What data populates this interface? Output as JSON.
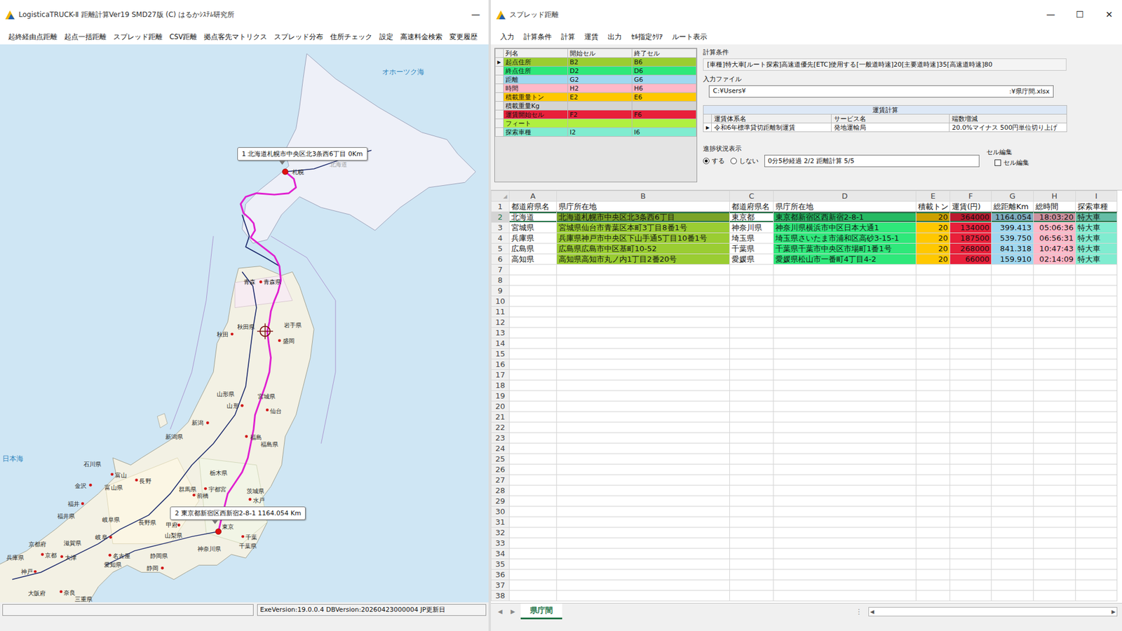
{
  "map_window": {
    "title": "LogisticaTRUCK-Ⅱ 距離計算Ver19 SMD27版 (C) はるかｼｽﾃﾑ研究所",
    "controls": [
      "—"
    ],
    "menu": [
      "起終経由点距離",
      "起点一括距離",
      "スプレッド距離",
      "CSV距離",
      "拠点客先マトリクス",
      "スプレッド分布",
      "住所チェック",
      "設定",
      "高速料金検索",
      "変更履歴"
    ],
    "labels": [
      {
        "text": "オホーツク海",
        "kind": "sea"
      },
      {
        "text": "日本海",
        "kind": "sea"
      },
      {
        "text": "北海道",
        "kind": "region"
      },
      {
        "text": "札幌",
        "kind": "pref"
      },
      {
        "text": "青森",
        "kind": "city"
      },
      {
        "text": "青森県",
        "kind": "pref"
      },
      {
        "text": "秋田県",
        "kind": "pref"
      },
      {
        "text": "秋田",
        "kind": "city"
      },
      {
        "text": "岩手県",
        "kind": "pref"
      },
      {
        "text": "盛岡",
        "kind": "city"
      },
      {
        "text": "山形県",
        "kind": "pref"
      },
      {
        "text": "山形",
        "kind": "city"
      },
      {
        "text": "宮城県",
        "kind": "pref"
      },
      {
        "text": "仙台",
        "kind": "city"
      },
      {
        "text": "新潟",
        "kind": "city"
      },
      {
        "text": "新潟県",
        "kind": "pref"
      },
      {
        "text": "福島",
        "kind": "city"
      },
      {
        "text": "福島県",
        "kind": "pref"
      },
      {
        "text": "栃木県",
        "kind": "pref"
      },
      {
        "text": "宇都宮",
        "kind": "city"
      },
      {
        "text": "群馬県",
        "kind": "pref"
      },
      {
        "text": "前橋",
        "kind": "city"
      },
      {
        "text": "茨城県",
        "kind": "pref"
      },
      {
        "text": "水戸",
        "kind": "city"
      },
      {
        "text": "石川県",
        "kind": "pref"
      },
      {
        "text": "富山",
        "kind": "city"
      },
      {
        "text": "金沢",
        "kind": "city"
      },
      {
        "text": "富山県",
        "kind": "pref"
      },
      {
        "text": "長野",
        "kind": "city"
      },
      {
        "text": "福井",
        "kind": "city"
      },
      {
        "text": "福井県",
        "kind": "pref"
      },
      {
        "text": "岐阜県",
        "kind": "pref"
      },
      {
        "text": "長野県",
        "kind": "pref"
      },
      {
        "text": "甲府",
        "kind": "city"
      },
      {
        "text": "山梨県",
        "kind": "pref"
      },
      {
        "text": "東京",
        "kind": "pref"
      },
      {
        "text": "千葉",
        "kind": "city"
      },
      {
        "text": "千葉県",
        "kind": "pref"
      },
      {
        "text": "神奈川県",
        "kind": "pref"
      },
      {
        "text": "岐阜",
        "kind": "city"
      },
      {
        "text": "名古屋",
        "kind": "city"
      },
      {
        "text": "愛知県",
        "kind": "pref"
      },
      {
        "text": "静岡県",
        "kind": "pref"
      },
      {
        "text": "静岡",
        "kind": "city"
      },
      {
        "text": "滋賀県",
        "kind": "pref"
      },
      {
        "text": "京都府",
        "kind": "pref"
      },
      {
        "text": "京都",
        "kind": "city"
      },
      {
        "text": "大津",
        "kind": "city"
      },
      {
        "text": "兵庫県",
        "kind": "pref"
      },
      {
        "text": "神戸",
        "kind": "city"
      },
      {
        "text": "大阪府",
        "kind": "pref"
      },
      {
        "text": "奈良",
        "kind": "city"
      },
      {
        "text": "三重県",
        "kind": "pref"
      }
    ],
    "callouts": [
      "1 北海道札幌市中央区北3条西6丁目 0Km",
      "2 東京都新宿区西新宿2-8-1 1164.054 Km"
    ],
    "status_bar": {
      "version": "ExeVersion:19.0.0.4 DBVersion:20260423000004 JP更新日"
    }
  },
  "spread_window": {
    "title": "スプレッド距離",
    "controls": [
      "—",
      "☐",
      "✕"
    ],
    "menu": [
      "入力",
      "計算条件",
      "計算",
      "運賃",
      "出力",
      "ｾﾙ指定ｸﾘｱ",
      "ルート表示"
    ],
    "column_map": {
      "row_indicator": "▶",
      "headers": [
        "列名",
        "開始セル",
        "終了セル"
      ],
      "rows": [
        {
          "cells": [
            "起点住所",
            "B2",
            "B6"
          ],
          "color": "#9acd32",
          "current": true
        },
        {
          "cells": [
            "終点住所",
            "D2",
            "D6"
          ],
          "color": "#2ee87a",
          "current": false
        },
        {
          "cells": [
            "距離",
            "G2",
            "G6"
          ],
          "color": "#a0d8f0",
          "current": false
        },
        {
          "cells": [
            "時間",
            "H2",
            "H6"
          ],
          "color": "#ffb8c8",
          "current": false
        },
        {
          "cells": [
            "積載重量トン",
            "E2",
            "E6"
          ],
          "color": "#ffc800",
          "current": false
        },
        {
          "cells": [
            "積載重量Kg",
            "",
            ""
          ],
          "color": "#d4d4d4",
          "current": false
        },
        {
          "cells": [
            "運賃開始セル",
            "F2",
            "F6"
          ],
          "color": "#e8203a",
          "current": false
        },
        {
          "cells": [
            "フィート",
            "",
            ""
          ],
          "color": "#b0f040",
          "current": false
        },
        {
          "cells": [
            "探索車種",
            "I2",
            "I6"
          ],
          "color": "#80ecd0",
          "current": false
        }
      ]
    },
    "conditions": {
      "label": "計算条件",
      "text": "[車種]特大車[ルート探索]高速道優先[ETC]使用する[一般道時速]20[主要道時速]35[高速道時速]80"
    },
    "input_file": {
      "label": "入力ファイル",
      "path_start": "C:¥Users¥",
      "path_end": ":¥県庁間.xlsx"
    },
    "fare": {
      "title": "運賃計算",
      "row_indicator": "▶",
      "headers": [
        "運賃体系名",
        "サービス名",
        "端数増減"
      ],
      "rows": [
        {
          "cells": [
            "令和6年標準貸切距離制運賃",
            "発地運輸局",
            "20.0%マイナス 500円単位切り上げ"
          ],
          "current": true
        }
      ]
    },
    "progress": {
      "label": "進捗状況表示",
      "options": [
        {
          "label": "する",
          "selected": true
        },
        {
          "label": "しない",
          "selected": false
        }
      ],
      "text": "0分5秒経過 2/2 距離計算 5/5"
    },
    "cell_edit": {
      "label": "セル編集",
      "box_label": "セル編集",
      "checked": false
    },
    "sheet": {
      "corner": "◢",
      "columns": [
        {
          "letter": "A",
          "color": "#ffffff"
        },
        {
          "letter": "B",
          "color": "#9acd32"
        },
        {
          "letter": "C",
          "color": "#ffffff"
        },
        {
          "letter": "D",
          "color": "#2ee87a"
        },
        {
          "letter": "E",
          "color": "#ffc800"
        },
        {
          "letter": "F",
          "color": "#e8203a"
        },
        {
          "letter": "G",
          "color": "#a0d8f0"
        },
        {
          "letter": "H",
          "color": "#ffb8c8"
        },
        {
          "letter": "I",
          "color": "#80ecd0"
        }
      ],
      "header_row": {
        "num": "1",
        "cells": [
          "都道府県名",
          "県庁所在地",
          "都道府県名",
          "県庁所在地",
          "積載トン",
          "運賃(円)",
          "総距離Km",
          "総時間",
          "探索車種"
        ]
      },
      "rows": [
        {
          "num": "2",
          "selected": true,
          "cells": [
            "北海道",
            "北海道札幌市中央区北3条西6丁目",
            "東京都",
            "東京都新宿区西新宿2-8-1",
            "20",
            "364000",
            "1164.054",
            "18:03:20",
            "特大車"
          ]
        },
        {
          "num": "3",
          "selected": false,
          "cells": [
            "宮城県",
            "宮城県仙台市青葉区本町3丁目8番1号",
            "神奈川県",
            "神奈川県横浜市中区日本大通1",
            "20",
            "134000",
            "399.413",
            "05:06:36",
            "特大車"
          ]
        },
        {
          "num": "4",
          "selected": false,
          "cells": [
            "兵庫県",
            "兵庫県神戸市中央区下山手通5丁目10番1号",
            "埼玉県",
            "埼玉県さいたま市浦和区高砂3-15-1",
            "20",
            "187500",
            "539.750",
            "06:56:31",
            "特大車"
          ]
        },
        {
          "num": "5",
          "selected": false,
          "cells": [
            "広島県",
            "広島県広島市中区基町10-52",
            "千葉県",
            "千葉県千葉市中央区市場町1番1号",
            "20",
            "268000",
            "841.318",
            "10:47:43",
            "特大車"
          ]
        },
        {
          "num": "6",
          "selected": false,
          "cells": [
            "高知県",
            "高知県高知市丸ノ内1丁目2番20号",
            "愛媛県",
            "愛媛県松山市一番町4丁目4-2",
            "20",
            "66000",
            "159.910",
            "02:14:09",
            "特大車"
          ]
        }
      ],
      "empty_rows": [
        "7",
        "8",
        "9",
        "10",
        "11",
        "12",
        "13",
        "14",
        "15",
        "16",
        "17",
        "18",
        "19",
        "20",
        "21",
        "22",
        "23",
        "24",
        "25",
        "26",
        "27",
        "28",
        "29",
        "30",
        "31",
        "32",
        "33",
        "34",
        "35",
        "36",
        "37",
        "38"
      ],
      "tab_nav": [
        "◀",
        "▶"
      ],
      "tabs": [
        {
          "label": "県庁間",
          "selected": true
        }
      ],
      "more": "⋮",
      "scroll_arrows": [
        "◀",
        "▶"
      ]
    }
  }
}
